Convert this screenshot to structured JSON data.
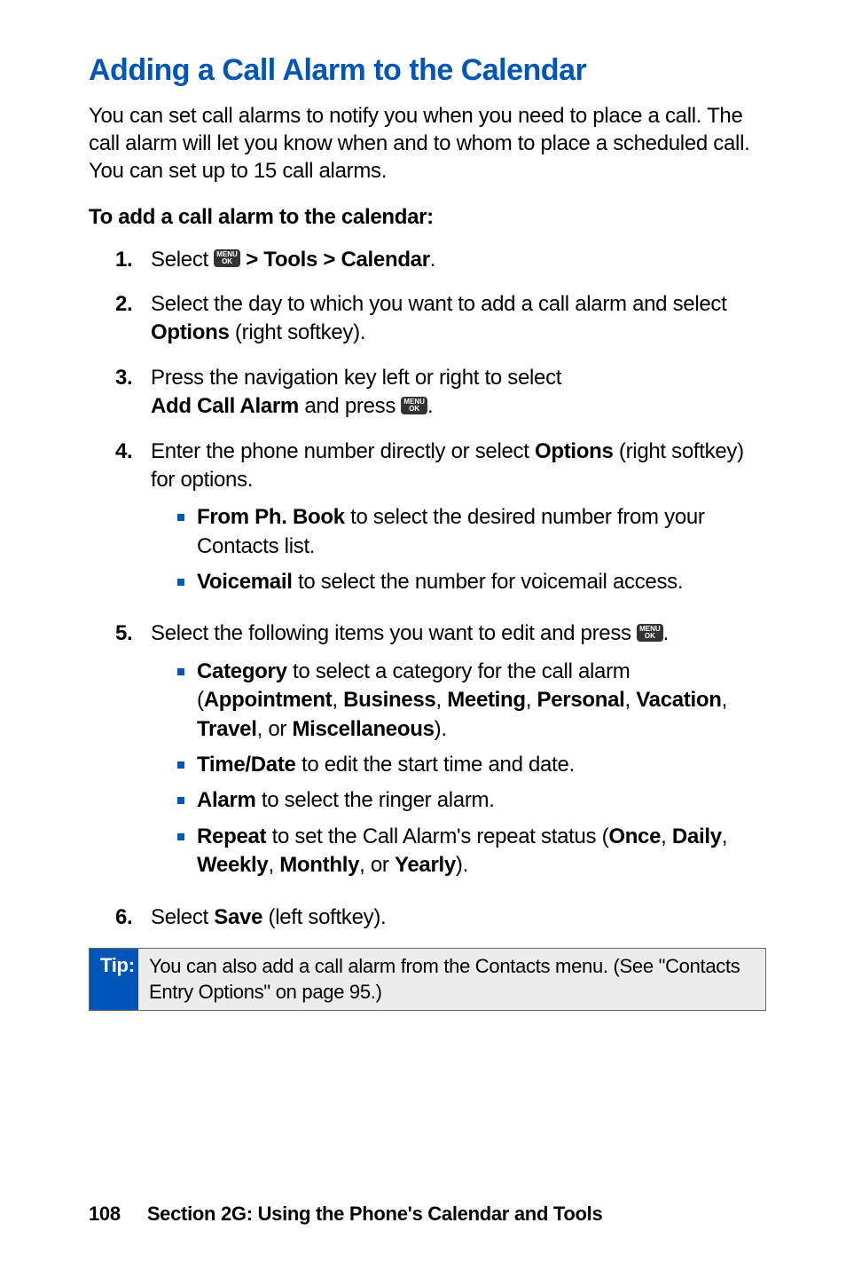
{
  "heading": "Adding a Call Alarm to the Calendar",
  "intro": "You can set call alarms to notify you when you need to place a call. The call alarm will let you know when and to whom to place a scheduled call. You can set up to 15 call alarms.",
  "subhead": "To add a call alarm to the calendar:",
  "menu_key": {
    "top": "MENU",
    "bottom": "OK"
  },
  "steps": {
    "s1": {
      "num": "1.",
      "pre": "Select ",
      "post": " > Tools > Calendar",
      "end": "."
    },
    "s2": {
      "num": "2.",
      "text_a": "Select the day to which you want to add a call alarm and select ",
      "bold": "Options",
      "text_b": " (right softkey)."
    },
    "s3": {
      "num": "3.",
      "line1": "Press the navigation key left or right to select",
      "bold": "Add Call Alarm",
      "mid": " and press ",
      "end": "."
    },
    "s4": {
      "num": "4.",
      "text_a": "Enter the phone number directly or select ",
      "bold": "Options",
      "text_b": " (right softkey) for options.",
      "sub": {
        "a": {
          "bold": "From Ph. Book",
          "rest": " to select the desired number from your Contacts list."
        },
        "b": {
          "bold": "Voicemail",
          "rest": " to select the number for voicemail access."
        }
      }
    },
    "s5": {
      "num": "5.",
      "text_a": "Select the following items you want to edit and press ",
      "end": ".",
      "sub": {
        "a": {
          "b1": "Category",
          "t1": " to select a category for the call alarm (",
          "b2": "Appointment",
          "t2": ", ",
          "b3": "Business",
          "t3": ", ",
          "b4": "Meeting",
          "t4": ", ",
          "b5": "Personal",
          "t5": ", ",
          "b6": "Vacation",
          "t6": ", ",
          "b7": "Travel",
          "t7": ", or ",
          "b8": "Miscellaneous",
          "t8": ")."
        },
        "b": {
          "bold": "Time/Date",
          "rest": " to edit the start time and date."
        },
        "c": {
          "bold": "Alarm",
          "rest": " to select the ringer alarm."
        },
        "d": {
          "b1": "Repeat",
          "t1": " to set the Call Alarm's repeat status (",
          "b2": "Once",
          "t2": ", ",
          "b3": "Daily",
          "t3": ", ",
          "b4": "Weekly",
          "t4": ", ",
          "b5": "Monthly",
          "t5": ", or ",
          "b6": "Yearly",
          "t6": ")."
        }
      }
    },
    "s6": {
      "num": "6.",
      "text_a": "Select ",
      "bold": "Save",
      "text_b": " (left softkey)."
    }
  },
  "tip": {
    "label": "Tip:",
    "text": "You can also add a call alarm from the Contacts menu. (See \"Contacts Entry Options\" on page 95.)"
  },
  "footer": {
    "page": "108",
    "section": "Section 2G: Using the Phone's Calendar and Tools"
  }
}
